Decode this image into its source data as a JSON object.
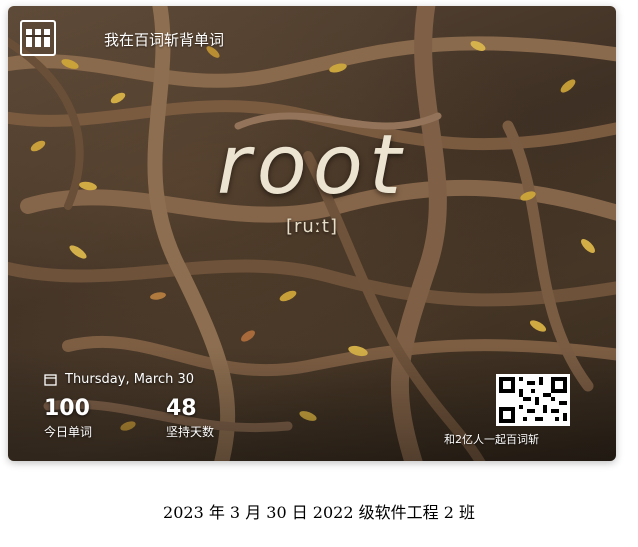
{
  "card": {
    "brand_text": "我在百词斩背单词",
    "word": "root",
    "phonetic": "[ruːt]",
    "date": "Thursday, March 30",
    "stats": [
      {
        "value": "100",
        "label": "今日单词"
      },
      {
        "value": "48",
        "label": "坚持天数"
      }
    ],
    "slogan": "和2亿人一起百词斩",
    "icons": {
      "logo": "baicizhan-logo",
      "calendar": "calendar-icon",
      "qr": "qr-code"
    }
  },
  "caption": "2023 年 3 月 30 日 2022 级软件工程 2 班",
  "colors": {
    "card_bg": "#3e3024",
    "word_color": "#ece4d0",
    "leaf_yellow": "#c9a23a"
  }
}
